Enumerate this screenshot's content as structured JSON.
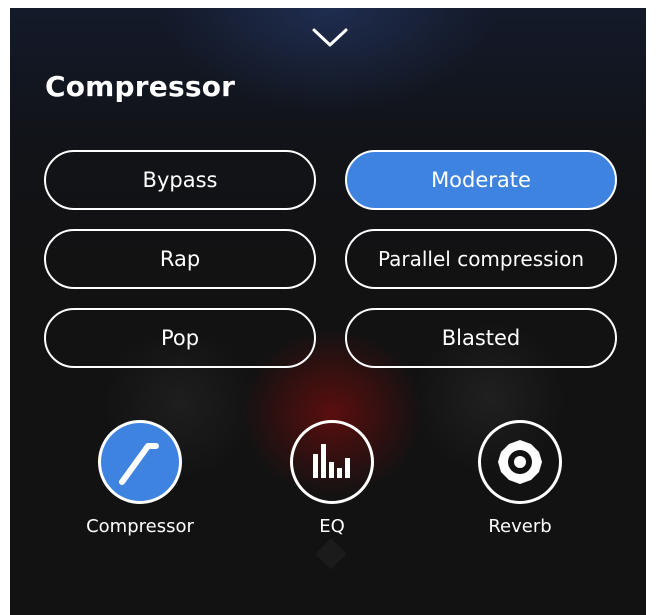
{
  "title": "Compressor",
  "presets": [
    {
      "label": "Bypass",
      "active": false
    },
    {
      "label": "Moderate",
      "active": true
    },
    {
      "label": "Rap",
      "active": false
    },
    {
      "label": "Parallel compression",
      "active": false
    },
    {
      "label": "Pop",
      "active": false
    },
    {
      "label": "Blasted",
      "active": false
    }
  ],
  "modules": [
    {
      "label": "Compressor",
      "icon": "compressor-curve-icon",
      "active": true
    },
    {
      "label": "EQ",
      "icon": "equalizer-bars-icon",
      "active": false
    },
    {
      "label": "Reverb",
      "icon": "reverb-ring-icon",
      "active": false
    }
  ],
  "colors": {
    "accent": "#3f83e0",
    "background": "#121212",
    "foreground": "#ffffff"
  }
}
